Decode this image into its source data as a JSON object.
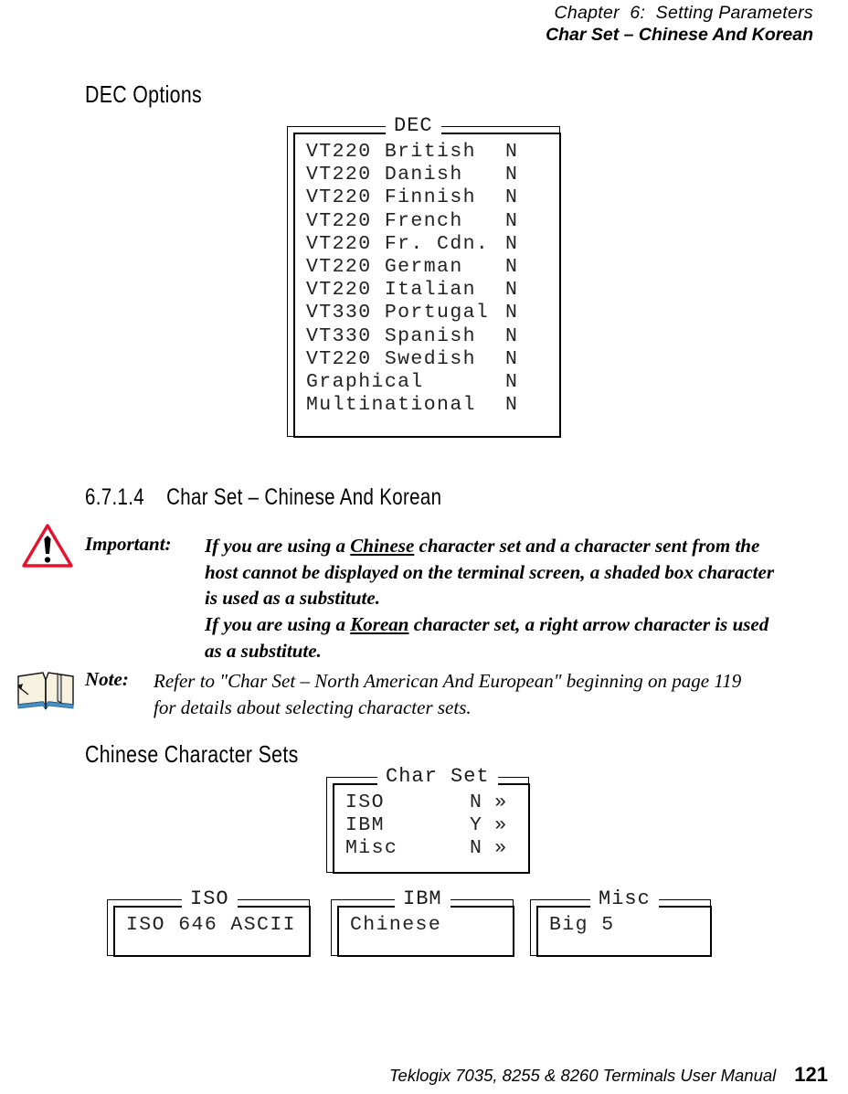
{
  "header": {
    "chapter": "Chapter  6:  Setting Parameters",
    "section": "Char Set – Chinese And Korean"
  },
  "dec_options": {
    "heading": "DEC Options",
    "dialog": {
      "title": "DEC",
      "rows": [
        {
          "label": "VT220 British",
          "value": "N"
        },
        {
          "label": "VT220 Danish",
          "value": "N"
        },
        {
          "label": "VT220 Finnish",
          "value": "N"
        },
        {
          "label": "VT220 French",
          "value": "N"
        },
        {
          "label": "VT220 Fr. Cdn.",
          "value": "N"
        },
        {
          "label": "VT220 German",
          "value": "N"
        },
        {
          "label": "VT220 Italian",
          "value": "N"
        },
        {
          "label": "VT330 Portugal",
          "value": "N"
        },
        {
          "label": "VT330 Spanish",
          "value": "N"
        },
        {
          "label": "VT220 Swedish",
          "value": "N"
        },
        {
          "label": "Graphical",
          "value": "N"
        },
        {
          "label": "Multinational",
          "value": "N"
        }
      ]
    }
  },
  "section_heading": {
    "number": "6.7.1.4",
    "title": "Char Set – Chinese And Korean"
  },
  "important": {
    "icon": "warning-triangle-icon",
    "label": "Important:",
    "para1_pre": "If you are using a ",
    "para1_underlined": "Chinese",
    "para1_post": " character set and a character sent from the host cannot be displayed on the terminal screen, a shaded box character is used as a substitute.",
    "para2_pre": "If you are using a ",
    "para2_underlined": "Korean",
    "para2_post": " character set, a right arrow character is used as a substitute."
  },
  "note": {
    "icon": "open-book-icon",
    "label": "Note:",
    "text": "Refer to \"Char Set – North American And European\" beginning on page 119 for details about selecting character sets."
  },
  "chinese_sets": {
    "heading": "Chinese Character Sets",
    "char_set_dialog": {
      "title": "Char Set",
      "rows": [
        {
          "label": "ISO",
          "value": "N",
          "chevron": "»"
        },
        {
          "label": "IBM",
          "value": "Y",
          "chevron": "»"
        },
        {
          "label": "Misc",
          "value": "N",
          "chevron": "»"
        }
      ]
    },
    "iso_dialog": {
      "title": "ISO",
      "value": "ISO 646 ASCII"
    },
    "ibm_dialog": {
      "title": "IBM",
      "value": "Chinese"
    },
    "misc_dialog": {
      "title": "Misc",
      "value": "Big 5"
    }
  },
  "footer": {
    "manual": "Teklogix 7035, 8255 & 8260 Terminals User Manual",
    "page": "121"
  },
  "colors": {
    "warning_triangle": "#e8112d",
    "book_page": "#f7f2e0",
    "book_edge": "#4a90c4",
    "text": "#000000"
  }
}
